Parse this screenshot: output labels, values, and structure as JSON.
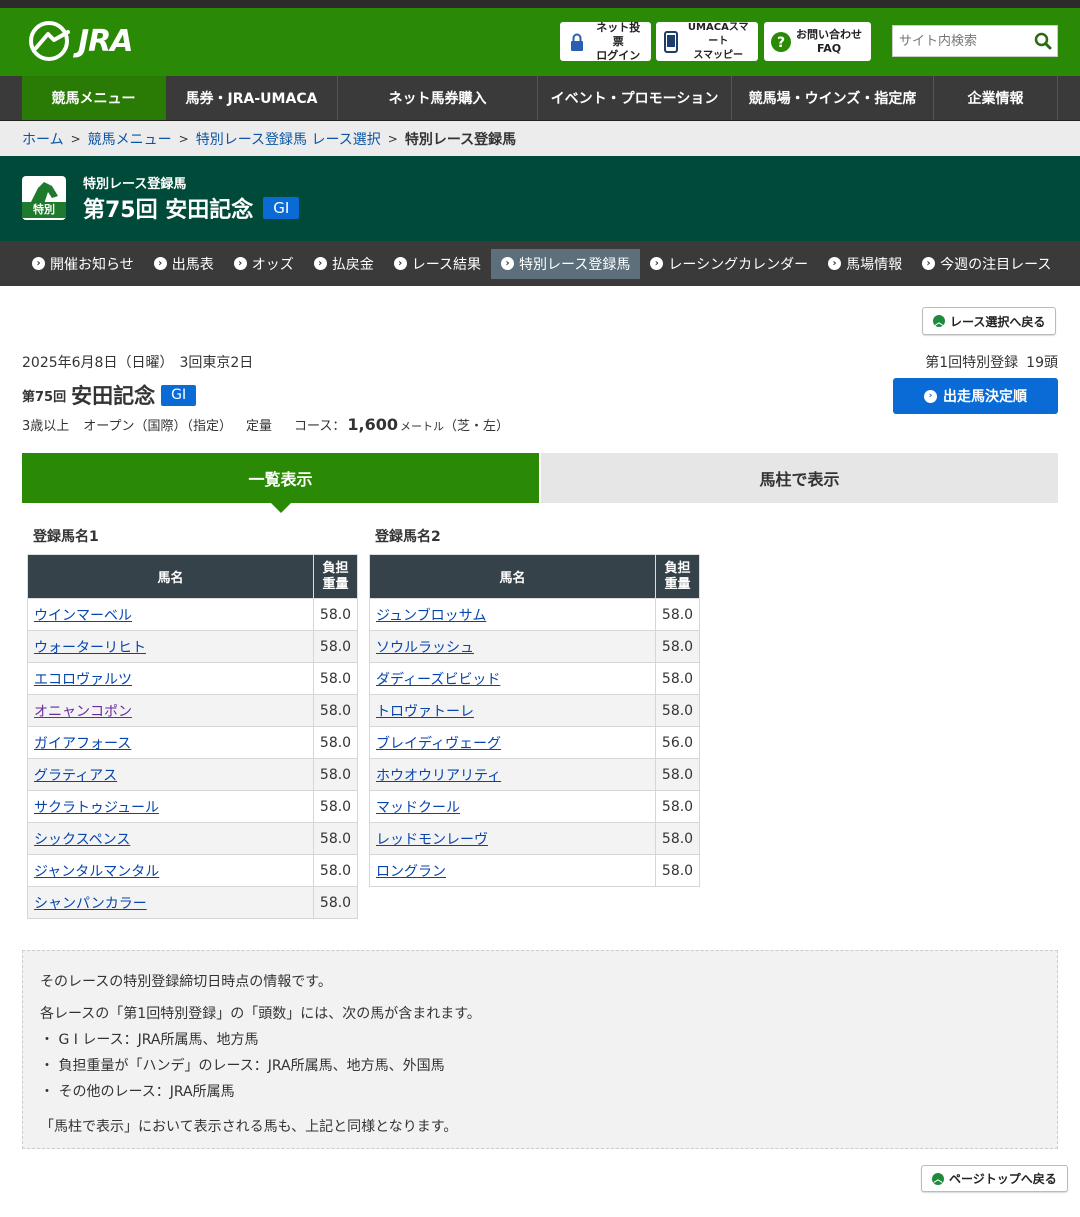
{
  "header": {
    "logo_text": "JRA",
    "buttons": [
      {
        "line1": "ネット投票",
        "line2": "ログイン"
      },
      {
        "line1": "UMACAスマート",
        "line2": "スマッピー"
      },
      {
        "line1": "お問い合わせ",
        "line2": "FAQ"
      }
    ],
    "search_placeholder": "サイト内検索"
  },
  "gnav": [
    "競馬メニュー",
    "馬券・JRA-UMACA",
    "ネット馬券購入",
    "イベント・プロモーション",
    "競馬場・ウインズ・指定席",
    "企業情報"
  ],
  "breadcrumb": {
    "items": [
      "ホーム",
      "競馬メニュー",
      "特別レース登録馬 レース選択"
    ],
    "current": "特別レース登録馬"
  },
  "race_header": {
    "badge": "特別",
    "subtitle": "特別レース登録馬",
    "title": "第75回 安田記念",
    "grade": "GⅠ"
  },
  "subnav": [
    "開催お知らせ",
    "出馬表",
    "オッズ",
    "払戻金",
    "レース結果",
    "特別レース登録馬",
    "レーシングカレンダー",
    "馬場情報",
    "今週の注目レース"
  ],
  "back_button": "レース選択へ戻る",
  "race_info": {
    "date": "2025年6月8日（日曜）",
    "meeting": "3回東京2日",
    "registration": "第1回特別登録",
    "head_count": "19頭",
    "number": "第75回",
    "name": "安田記念",
    "grade": "GⅠ",
    "age": "3歳以上",
    "class": "オープン（国際）（指定）",
    "weight_type": "定量",
    "course_label": "コース：",
    "distance": "1,600",
    "unit": "メートル",
    "surface": "（芝・左）"
  },
  "shutsuba_button": "出走馬決定順",
  "tabs": {
    "list": "一覧表示",
    "column": "馬柱で表示"
  },
  "table_headers": {
    "name": "馬名",
    "weight_l1": "負担",
    "weight_l2": "重量"
  },
  "tables": [
    {
      "caption": "登録馬名1",
      "rows": [
        {
          "name": "ウインマーベル",
          "weight": "58.0"
        },
        {
          "name": "ウォーターリヒト",
          "weight": "58.0"
        },
        {
          "name": "エコロヴァルツ",
          "weight": "58.0"
        },
        {
          "name": "オニャンコポン",
          "weight": "58.0"
        },
        {
          "name": "ガイアフォース",
          "weight": "58.0"
        },
        {
          "name": "グラティアス",
          "weight": "58.0"
        },
        {
          "name": "サクラトゥジュール",
          "weight": "58.0"
        },
        {
          "name": "シックスペンス",
          "weight": "58.0"
        },
        {
          "name": "ジャンタルマンタル",
          "weight": "58.0"
        },
        {
          "name": "シャンパンカラー",
          "weight": "58.0"
        }
      ]
    },
    {
      "caption": "登録馬名2",
      "rows": [
        {
          "name": "ジュンブロッサム",
          "weight": "58.0"
        },
        {
          "name": "ソウルラッシュ",
          "weight": "58.0"
        },
        {
          "name": "ダディーズビビッド",
          "weight": "58.0"
        },
        {
          "name": "トロヴァトーレ",
          "weight": "58.0"
        },
        {
          "name": "ブレイディヴェーグ",
          "weight": "56.0"
        },
        {
          "name": "ホウオウリアリティ",
          "weight": "58.0"
        },
        {
          "name": "マッドクール",
          "weight": "58.0"
        },
        {
          "name": "レッドモンレーヴ",
          "weight": "58.0"
        },
        {
          "name": "ロングラン",
          "weight": "58.0"
        }
      ]
    }
  ],
  "notes": {
    "line1": "そのレースの特別登録締切日時点の情報です。",
    "line2": "各レースの「第1回特別登録」の「頭数」には、次の馬が含まれます。",
    "bullet1": "・ G Ⅰ レース：JRA所属馬、地方馬",
    "bullet2": "・ 負担重量が「ハンデ」のレース：JRA所属馬、地方馬、外国馬",
    "bullet3": "・ その他のレース：JRA所属馬",
    "line3": "「馬柱で表示」において表示される馬も、上記と同様となります。"
  },
  "page_top_button": "ページトップへ戻る",
  "colors": {
    "brand_green": "#2a8a06",
    "race_header": "#004a3a",
    "grade_blue": "#0a6bd6",
    "nav_dark": "#3a3a3a"
  }
}
